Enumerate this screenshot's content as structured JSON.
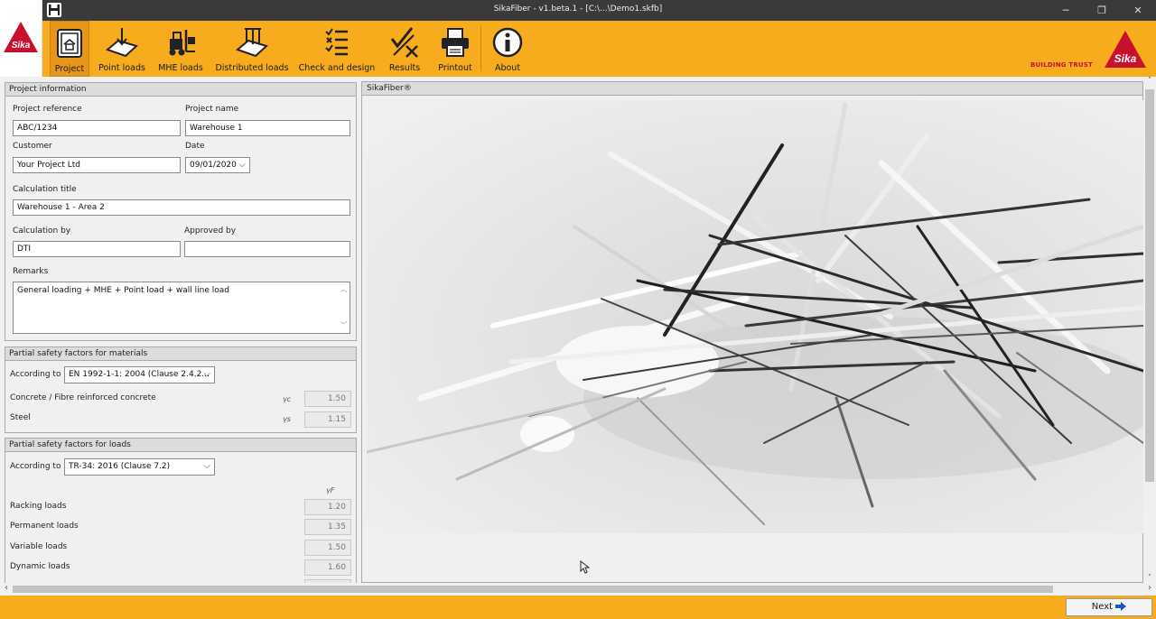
{
  "window": {
    "title": "SikaFiber - v1.beta.1 - [C:\\...\\Demo1.skfb]",
    "minimize": "─",
    "restore": "❐",
    "close": "✕"
  },
  "ribbon": {
    "items": [
      {
        "label": "Project",
        "icon": "project-icon"
      },
      {
        "label": "Point loads",
        "icon": "point-loads-icon"
      },
      {
        "label": "MHE loads",
        "icon": "forklift-icon"
      },
      {
        "label": "Distributed loads",
        "icon": "distributed-loads-icon"
      },
      {
        "label": "Check and design",
        "icon": "checklist-icon"
      },
      {
        "label": "Results",
        "icon": "results-icon"
      },
      {
        "label": "Printout",
        "icon": "printer-icon"
      },
      {
        "label": "About",
        "icon": "info-icon"
      }
    ],
    "brand_text": "BUILDING TRUST",
    "logo_text": "Sika"
  },
  "project_info": {
    "header": "Project information",
    "reference_label": "Project reference",
    "reference_value": "ABC/1234",
    "name_label": "Project name",
    "name_value": "Warehouse 1",
    "customer_label": "Customer",
    "customer_value": "Your Project Ltd",
    "date_label": "Date",
    "date_value": "09/01/2020",
    "calc_title_label": "Calculation title",
    "calc_title_value": "Warehouse 1 - Area 2",
    "calc_by_label": "Calculation by",
    "calc_by_value": "DTI",
    "approved_by_label": "Approved by",
    "approved_by_value": "",
    "remarks_label": "Remarks",
    "remarks_value": "General loading + MHE + Point load + wall line load"
  },
  "materials": {
    "header": "Partial safety factors for materials",
    "according_label": "According to",
    "according_value": "EN 1992-1-1: 2004 (Clause 2.4.2...",
    "concrete_label": "Concrete / Fibre reinforced concrete",
    "concrete_symbol": "γc",
    "concrete_value": "1.50",
    "steel_label": "Steel",
    "steel_symbol": "γs",
    "steel_value": "1.15"
  },
  "loads": {
    "header": "Partial safety factors for loads",
    "according_label": "According to",
    "according_value": "TR-34: 2016 (Clause 7.2)",
    "symbol": "γF",
    "rows": [
      {
        "label": "Racking loads",
        "value": "1.20"
      },
      {
        "label": "Permanent loads",
        "value": "1.35"
      },
      {
        "label": "Variable loads",
        "value": "1.50"
      },
      {
        "label": "Dynamic loads",
        "value": "1.60"
      }
    ]
  },
  "right_panel": {
    "header": "SikaFiber®"
  },
  "footer": {
    "next_label": "Next"
  },
  "colors": {
    "ribbon": "#f6ac1c",
    "sika_red": "#c8102e",
    "titlebar": "#3a3a3a"
  }
}
